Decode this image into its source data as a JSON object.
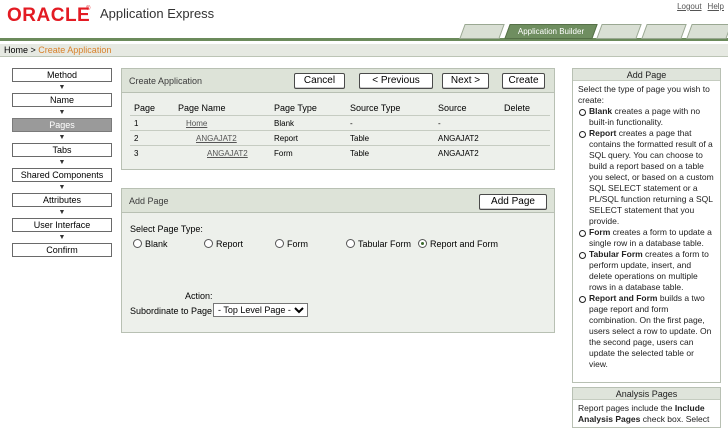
{
  "header": {
    "logo": "ORACLE",
    "reg": "®",
    "app_name": "Application Express",
    "links": [
      "Logout",
      "Help"
    ],
    "tab_label": "Application Builder"
  },
  "breadcrumb": {
    "home": "Home",
    "sep": " > ",
    "current": "Create Application"
  },
  "steps": [
    "Method",
    "Name",
    "Pages",
    "Tabs",
    "Shared Components",
    "Attributes",
    "User Interface",
    "Confirm"
  ],
  "active_step": "Pages",
  "create_region": {
    "title": "Create Application",
    "cancel": "Cancel",
    "previous": "< Previous",
    "next": "Next >",
    "create": "Create",
    "columns": [
      "Page",
      "Page Name",
      "Page Type",
      "Source Type",
      "Source",
      "Delete"
    ],
    "rows": [
      [
        "1",
        "Home",
        "Blank",
        "-",
        "-",
        ""
      ],
      [
        "2",
        "ANGAJAT2",
        "Report",
        "Table",
        "ANGAJAT2",
        ""
      ],
      [
        "3",
        "ANGAJAT2",
        "Form",
        "Table",
        "ANGAJAT2",
        ""
      ]
    ]
  },
  "add_region": {
    "title": "Add Page",
    "add_button": "Add Page",
    "select_label": "Select Page Type:",
    "types": [
      "Blank",
      "Report",
      "Form",
      "Tabular Form",
      "Report and Form"
    ],
    "selected": "Report and Form",
    "action_label": "Action:",
    "subordinate_label": "Subordinate to Page",
    "subordinate_value": "- Top Level Page -"
  },
  "help": {
    "title": "Add Page",
    "intro": "Select the type of page you wish to create:",
    "items": [
      {
        "term": "Blank",
        "text": " creates a page with no built-in functionality."
      },
      {
        "term": "Report",
        "text": " creates a page that contains the formatted result of a SQL query. You can choose to build a report based on a table you select, or based on a custom SQL SELECT statement or a PL/SQL function returning a SQL SELECT statement that you provide."
      },
      {
        "term": "Form",
        "text": " creates a form to update a single row in a database table."
      },
      {
        "term": "Tabular Form",
        "text": " creates a form to perform update, insert, and delete operations on multiple rows in a database table."
      },
      {
        "term": "Report and Form",
        "text": " builds a two page report and form combination. On the first page, users select a row to update. On the second page, users can update the selected table or view."
      }
    ]
  },
  "help2": {
    "title": "Analysis Pages",
    "text_a": "Report pages include the ",
    "term": "Include Analysis Pages",
    "text_b": " check box. Select"
  }
}
